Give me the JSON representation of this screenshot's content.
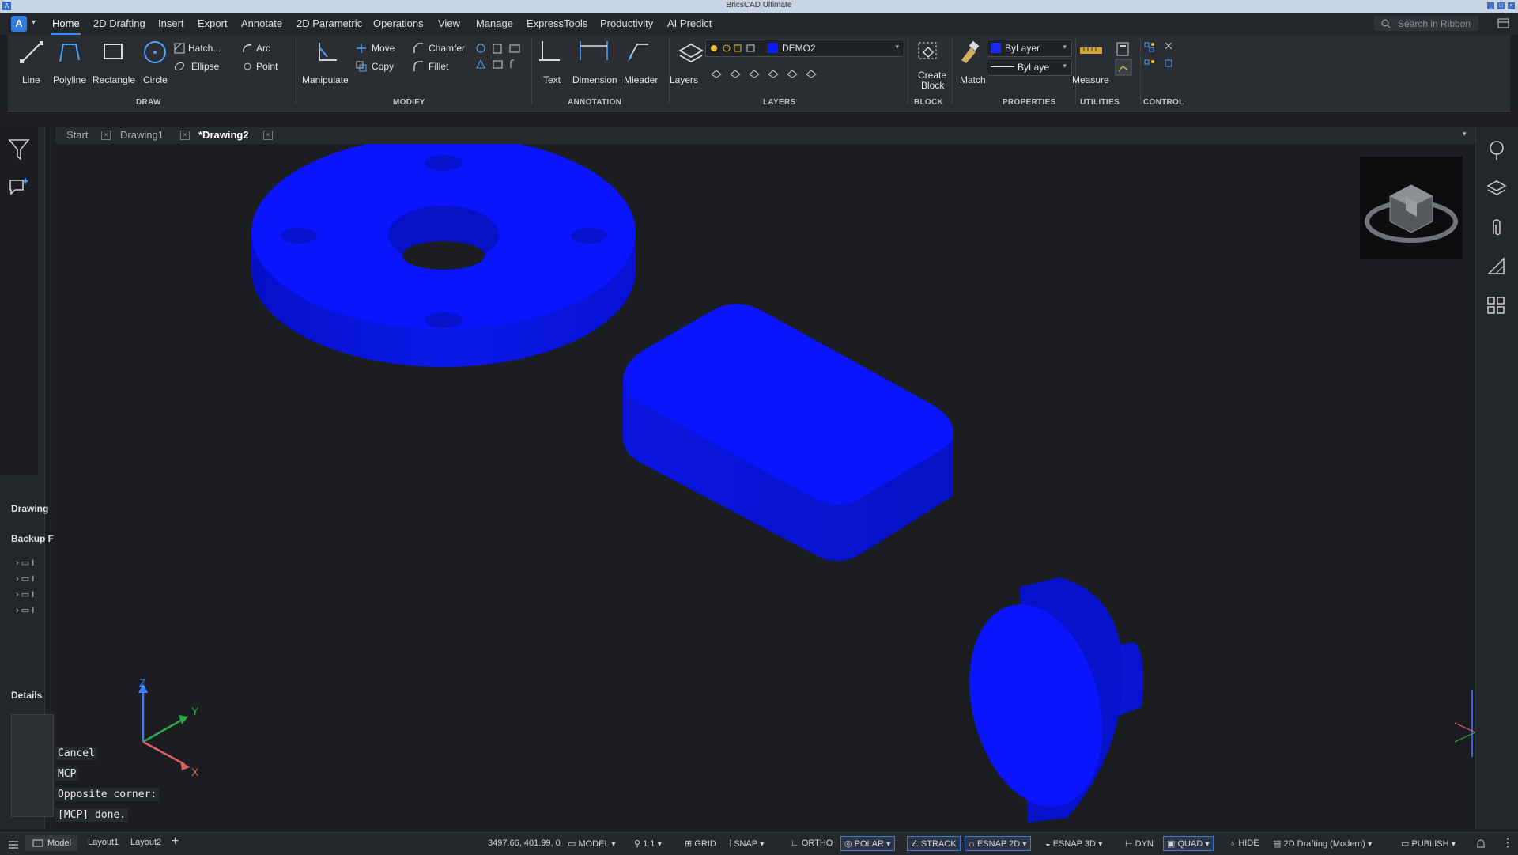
{
  "window": {
    "title": "BricsCAD Ultimate"
  },
  "menu": {
    "items": [
      "Home",
      "2D Drafting",
      "Insert",
      "Export",
      "Annotate",
      "2D Parametric",
      "Operations",
      "View",
      "Manage",
      "ExpressTools",
      "Productivity",
      "AI Predict"
    ],
    "active": "Home",
    "search_placeholder": "Search in Ribbon"
  },
  "ribbon": {
    "draw": {
      "line": "Line",
      "polyline": "Polyline",
      "rectangle": "Rectangle",
      "circle": "Circle",
      "hatch": "Hatch...",
      "arc": "Arc",
      "ellipse": "Ellipse",
      "point": "Point",
      "panel": "DRAW"
    },
    "modify": {
      "manipulate": "Manipulate",
      "move": "Move",
      "copy": "Copy",
      "chamfer": "Chamfer",
      "fillet": "Fillet",
      "panel": "MODIFY"
    },
    "annotation": {
      "text": "Text",
      "dimension": "Dimension",
      "mleader": "Mleader",
      "panel": "ANNOTATION"
    },
    "layers": {
      "layers": "Layers",
      "current_layer": "DEMO2",
      "layer_color": "#0a1cff",
      "panel": "LAYERS"
    },
    "block": {
      "create_block_line1": "Create",
      "create_block_line2": "Block",
      "panel": "BLOCK"
    },
    "properties": {
      "match": "Match",
      "color": "ByLayer",
      "linetype": "ByLaye",
      "color_swatch": "#1a2aff",
      "panel": "PROPERTIES"
    },
    "utilities": {
      "measure": "Measure",
      "panel": "UTILITIES"
    },
    "control": {
      "panel": "CONTROL"
    }
  },
  "left_panel": {
    "drawing": "Drawing",
    "backup": "Backup F",
    "tree_items": [
      "I",
      "I",
      "I",
      "I"
    ],
    "details": "Details"
  },
  "tabs": [
    {
      "label": "Start",
      "active": false
    },
    {
      "label": "Drawing1",
      "active": false
    },
    {
      "label": "*Drawing2",
      "active": true
    }
  ],
  "viewport": {
    "solid_color": "#0a14ff",
    "axis": {
      "x": "X",
      "y": "Y",
      "z": "Z"
    }
  },
  "command_history": [
    "Cancel",
    "MCP",
    "Opposite corner:",
    "[MCP] done."
  ],
  "status": {
    "layouts": [
      "Model",
      "Layout1",
      "Layout2"
    ],
    "coordinates": "3497.66, 401.99, 0",
    "space": "MODEL",
    "scale": "1:1",
    "toggles": [
      "GRID",
      "SNAP",
      "ORTHO",
      "POLAR",
      "STRACK",
      "ESNAP 2D",
      "ESNAP 3D",
      "DYN",
      "QUAD",
      "HIDE"
    ],
    "toggles_on": [
      "POLAR",
      "STRACK",
      "ESNAP 2D",
      "QUAD"
    ],
    "workspace": "2D Drafting (Modern)",
    "publish": "PUBLISH"
  }
}
